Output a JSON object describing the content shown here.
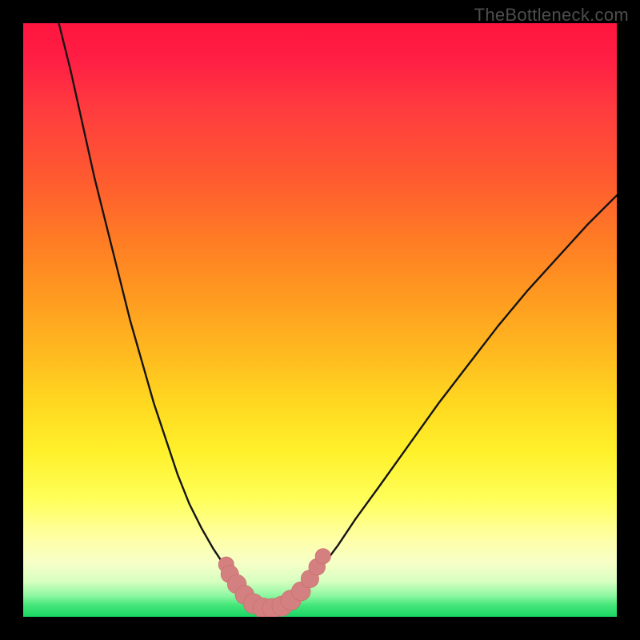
{
  "watermark": "TheBottleneck.com",
  "colors": {
    "frame": "#000000",
    "gradient_top": "#ff153f",
    "gradient_mid": "#ffd820",
    "gradient_bottom": "#19d663",
    "curve_stroke": "#141414",
    "marker_fill": "#d58080",
    "marker_stroke": "#c46a6a"
  },
  "chart_data": {
    "type": "line",
    "title": "",
    "xlabel": "",
    "ylabel": "",
    "xlim": [
      0,
      100
    ],
    "ylim": [
      0,
      100
    ],
    "grid": false,
    "legend": false,
    "series": [
      {
        "name": "left-branch",
        "x": [
          6,
          8,
          10,
          12,
          14,
          16,
          18,
          20,
          22,
          24,
          26,
          28,
          30,
          32,
          34,
          35,
          36,
          37,
          38.5
        ],
        "y": [
          100,
          92,
          83,
          74,
          66,
          58,
          50,
          43,
          36,
          30,
          24,
          19,
          15,
          11.5,
          8.5,
          7,
          5.5,
          4,
          2
        ]
      },
      {
        "name": "valley-floor",
        "x": [
          38.5,
          40,
          41.5,
          43,
          44.5,
          46
        ],
        "y": [
          2,
          1.5,
          1.3,
          1.5,
          2.2,
          3.2
        ]
      },
      {
        "name": "right-branch",
        "x": [
          46,
          48,
          50,
          53,
          56,
          60,
          65,
          70,
          75,
          80,
          85,
          90,
          95,
          100
        ],
        "y": [
          3.2,
          5.5,
          8,
          12,
          16.5,
          22,
          29,
          36,
          42.5,
          49,
          55,
          60.5,
          66,
          71
        ]
      }
    ],
    "markers": [
      {
        "x": 34.2,
        "y": 8.8,
        "r": 1.3
      },
      {
        "x": 34.8,
        "y": 7.2,
        "r": 1.5
      },
      {
        "x": 36.0,
        "y": 5.5,
        "r": 1.6
      },
      {
        "x": 37.3,
        "y": 3.7,
        "r": 1.6
      },
      {
        "x": 38.8,
        "y": 2.2,
        "r": 1.7
      },
      {
        "x": 40.4,
        "y": 1.5,
        "r": 1.7
      },
      {
        "x": 42.0,
        "y": 1.4,
        "r": 1.7
      },
      {
        "x": 43.6,
        "y": 1.8,
        "r": 1.7
      },
      {
        "x": 45.1,
        "y": 2.8,
        "r": 1.7
      },
      {
        "x": 46.8,
        "y": 4.3,
        "r": 1.6
      },
      {
        "x": 48.3,
        "y": 6.4,
        "r": 1.5
      },
      {
        "x": 49.5,
        "y": 8.4,
        "r": 1.4
      },
      {
        "x": 50.5,
        "y": 10.2,
        "r": 1.3
      }
    ]
  }
}
